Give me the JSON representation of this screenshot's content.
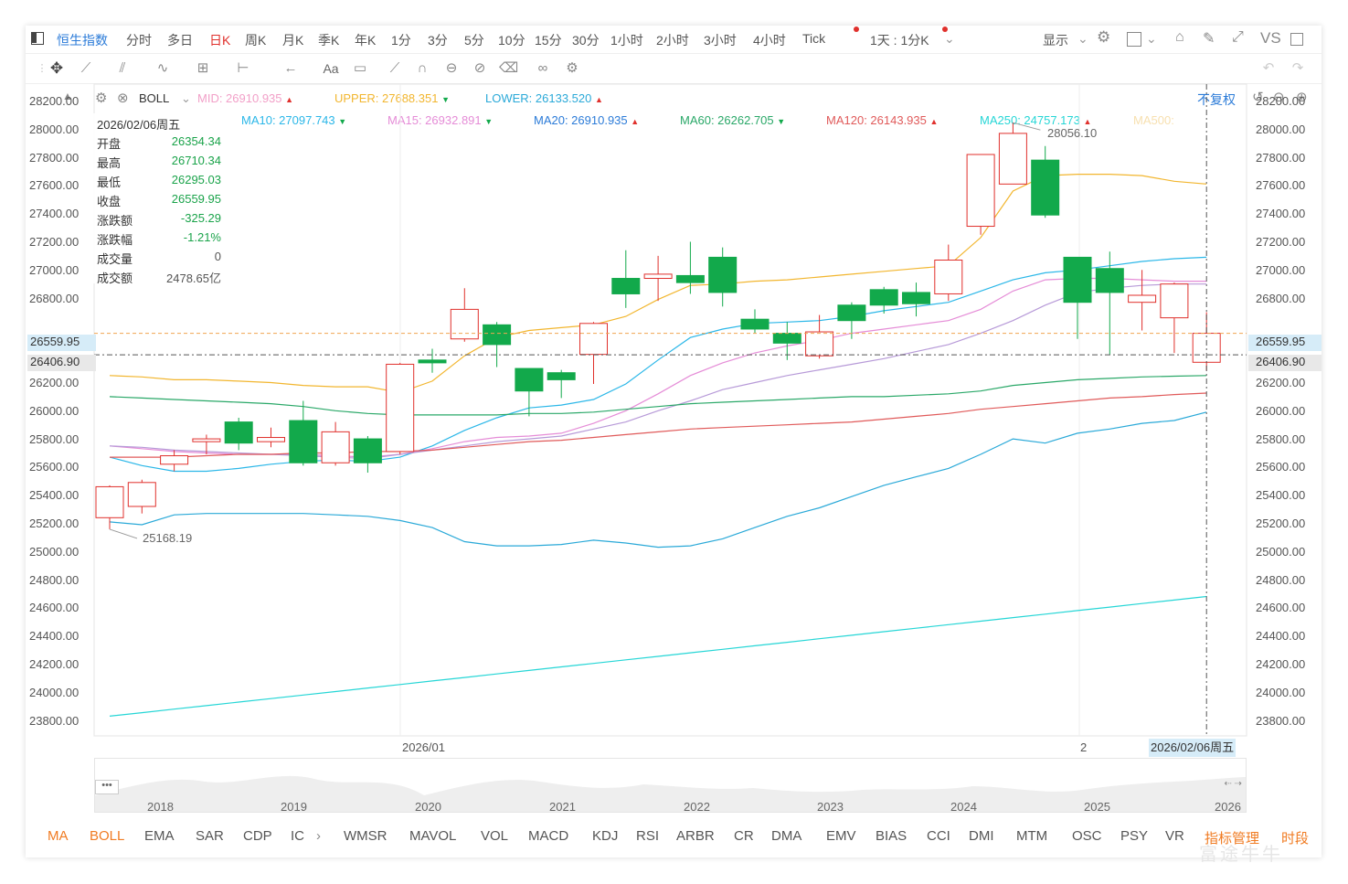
{
  "toolbar": {
    "title": "恒生指数",
    "periods": [
      "分时",
      "多日",
      "日K",
      "周K",
      "月K",
      "季K",
      "年K",
      "1分",
      "3分",
      "5分",
      "10分",
      "15分",
      "30分",
      "1小时",
      "2小时",
      "3小时",
      "4小时",
      "Tick"
    ],
    "active_period": "日K",
    "period_setting": "1天 : 1分K",
    "display_label": "显示",
    "vs_label": "VS"
  },
  "indicator": {
    "name": "BOLL",
    "mid": "MID:  26910.935",
    "upper": "UPPER:  27688.351",
    "lower": "LOWER:  26133.520",
    "restore_label": "不复权"
  },
  "ma_line": {
    "ma10": "MA10:  27097.743",
    "ma15": "MA15:  26932.891",
    "ma20": "MA20:  26910.935",
    "ma60": "MA60:  26262.705",
    "ma120": "MA120:  26143.935",
    "ma250": "MA250:  24757.173",
    "ma500": "MA500:"
  },
  "info": {
    "date": "2026/02/06周五",
    "rows": [
      {
        "k": "开盘",
        "v": "26354.34",
        "color": "#1aa34a"
      },
      {
        "k": "最高",
        "v": "26710.34",
        "color": "#1aa34a"
      },
      {
        "k": "最低",
        "v": "26295.03",
        "color": "#1aa34a"
      },
      {
        "k": "收盘",
        "v": "26559.95",
        "color": "#1aa34a"
      },
      {
        "k": "涨跌额",
        "v": "-325.29",
        "color": "#1aa34a"
      },
      {
        "k": "涨跌幅",
        "v": "-1.21%",
        "color": "#1aa34a"
      },
      {
        "k": "成交量",
        "v": "0",
        "color": "#555"
      },
      {
        "k": "成交额",
        "v": "2478.65亿",
        "color": "#555"
      }
    ]
  },
  "y_axis": [
    "28200.00",
    "28000.00",
    "27800.00",
    "27600.00",
    "27400.00",
    "27200.00",
    "27000.00",
    "26800.00",
    "26200.00",
    "26000.00",
    "25800.00",
    "25600.00",
    "25400.00",
    "25200.00",
    "25000.00",
    "24800.00",
    "24600.00",
    "24400.00",
    "24200.00",
    "24000.00",
    "23800.00"
  ],
  "price_labels": {
    "current": "26559.95",
    "crosshair": "26406.90"
  },
  "annotations": {
    "high": "28056.10",
    "low": "25168.19"
  },
  "x_axis": {
    "jan": "2026/01",
    "feb": "2",
    "cursor": "2026/02/06周五"
  },
  "overview_years": [
    "2018",
    "2019",
    "2020",
    "2021",
    "2022",
    "2023",
    "2024",
    "2025",
    "2026"
  ],
  "bottom_tabs": [
    "MA",
    "BOLL",
    "EMA",
    "SAR",
    "CDP",
    "IC",
    "WMSR",
    "MAVOL",
    "VOL",
    "MACD",
    "KDJ",
    "RSI",
    "ARBR",
    "CR",
    "DMA",
    "EMV",
    "BIAS",
    "CCI",
    "DMI",
    "MTM",
    "OSC",
    "PSY",
    "VR"
  ],
  "bottom_right": {
    "manage": "指标管理",
    "period": "时段"
  },
  "watermark": "富途牛牛",
  "colors": {
    "up": "#e0302c",
    "down": "#12a94b",
    "accent": "#2b7bd8",
    "orange": "#f07b22"
  },
  "chart_data": {
    "type": "candlestick",
    "candles": [
      {
        "o": 25250,
        "h": 25480,
        "l": 25168,
        "c": 25470
      },
      {
        "o": 25330,
        "h": 25520,
        "l": 25280,
        "c": 25500
      },
      {
        "o": 25630,
        "h": 25730,
        "l": 25580,
        "c": 25690
      },
      {
        "o": 25790,
        "h": 25840,
        "l": 25700,
        "c": 25810
      },
      {
        "o": 25930,
        "h": 25960,
        "l": 25730,
        "c": 25780
      },
      {
        "o": 25790,
        "h": 25890,
        "l": 25750,
        "c": 25820
      },
      {
        "o": 25940,
        "h": 26080,
        "l": 25620,
        "c": 25640
      },
      {
        "o": 25640,
        "h": 25930,
        "l": 25620,
        "c": 25860
      },
      {
        "o": 25810,
        "h": 25830,
        "l": 25570,
        "c": 25640
      },
      {
        "o": 25720,
        "h": 26350,
        "l": 25700,
        "c": 26340
      },
      {
        "o": 26370,
        "h": 26450,
        "l": 26280,
        "c": 26350
      },
      {
        "o": 26520,
        "h": 26880,
        "l": 26500,
        "c": 26730
      },
      {
        "o": 26620,
        "h": 26640,
        "l": 26320,
        "c": 26480
      },
      {
        "o": 26310,
        "h": 26310,
        "l": 25970,
        "c": 26150
      },
      {
        "o": 26280,
        "h": 26300,
        "l": 26100,
        "c": 26230
      },
      {
        "o": 26410,
        "h": 26640,
        "l": 26200,
        "c": 26630
      },
      {
        "o": 26950,
        "h": 27150,
        "l": 26740,
        "c": 26840
      },
      {
        "o": 26950,
        "h": 27110,
        "l": 26790,
        "c": 26980
      },
      {
        "o": 26970,
        "h": 27210,
        "l": 26840,
        "c": 26920
      },
      {
        "o": 27100,
        "h": 27170,
        "l": 26750,
        "c": 26850
      },
      {
        "o": 26660,
        "h": 26730,
        "l": 26560,
        "c": 26590
      },
      {
        "o": 26560,
        "h": 26640,
        "l": 26370,
        "c": 26490
      },
      {
        "o": 26400,
        "h": 26690,
        "l": 26380,
        "c": 26570
      },
      {
        "o": 26760,
        "h": 26780,
        "l": 26520,
        "c": 26650
      },
      {
        "o": 26870,
        "h": 26890,
        "l": 26700,
        "c": 26760
      },
      {
        "o": 26850,
        "h": 26920,
        "l": 26680,
        "c": 26770
      },
      {
        "o": 26840,
        "h": 27190,
        "l": 26790,
        "c": 27080
      },
      {
        "o": 27320,
        "h": 27830,
        "l": 27260,
        "c": 27830
      },
      {
        "o": 27620,
        "h": 28056,
        "l": 27620,
        "c": 27980
      },
      {
        "o": 27790,
        "h": 27890,
        "l": 27380,
        "c": 27400
      },
      {
        "o": 27100,
        "h": 27100,
        "l": 26520,
        "c": 26780
      },
      {
        "o": 27020,
        "h": 27140,
        "l": 26410,
        "c": 26850
      },
      {
        "o": 26780,
        "h": 27010,
        "l": 26580,
        "c": 26830
      },
      {
        "o": 26670,
        "h": 26920,
        "l": 26420,
        "c": 26910
      },
      {
        "o": 26354,
        "h": 26710,
        "l": 26295,
        "c": 26560
      }
    ],
    "lines": [
      {
        "name": "UPPER",
        "color": "#f2b62f",
        "v": [
          26260,
          26250,
          26230,
          26230,
          26220,
          26210,
          26190,
          26180,
          26180,
          26140,
          26220,
          26400,
          26530,
          26580,
          26600,
          26620,
          26680,
          26800,
          26900,
          26910,
          26930,
          26940,
          26960,
          26980,
          27000,
          27020,
          27040,
          27240,
          27570,
          27680,
          27690,
          27690,
          27680,
          27640,
          27620,
          27688
        ]
      },
      {
        "name": "MA10",
        "color": "#2bb7e8",
        "v": [
          25680,
          25620,
          25580,
          25580,
          25600,
          25630,
          25650,
          25660,
          25650,
          25680,
          25760,
          25870,
          25960,
          26030,
          26050,
          26090,
          26200,
          26370,
          26530,
          26590,
          26630,
          26640,
          26650,
          26680,
          26720,
          26750,
          26780,
          26860,
          26940,
          26990,
          27010,
          27040,
          27070,
          27090,
          27100,
          27098
        ]
      },
      {
        "name": "MA15",
        "color": "#e58cd7",
        "v": [
          25760,
          25740,
          25720,
          25710,
          25700,
          25700,
          25700,
          25690,
          25680,
          25700,
          25740,
          25790,
          25820,
          25830,
          25850,
          25920,
          26010,
          26130,
          26260,
          26350,
          26420,
          26470,
          26510,
          26560,
          26590,
          26620,
          26650,
          26730,
          26860,
          26940,
          26950,
          26950,
          26940,
          26930,
          26930,
          26933
        ]
      },
      {
        "name": "MA20",
        "color": "#b79ad8",
        "v": [
          25760,
          25750,
          25730,
          25720,
          25710,
          25700,
          25690,
          25680,
          25670,
          25700,
          25730,
          25760,
          25790,
          25810,
          25830,
          25880,
          25930,
          26010,
          26080,
          26160,
          26210,
          26260,
          26300,
          26340,
          26380,
          26430,
          26480,
          26560,
          26650,
          26760,
          26850,
          26880,
          26900,
          26910,
          26910,
          26911
        ]
      },
      {
        "name": "MA60",
        "color": "#2aa868",
        "v": [
          26110,
          26100,
          26090,
          26080,
          26070,
          26060,
          26040,
          26010,
          25990,
          25980,
          25980,
          25980,
          25980,
          25990,
          25990,
          26000,
          26020,
          26040,
          26060,
          26070,
          26080,
          26090,
          26100,
          26110,
          26110,
          26120,
          26130,
          26150,
          26190,
          26210,
          26230,
          26240,
          26250,
          26255,
          26260,
          26263
        ]
      },
      {
        "name": "MA120",
        "color": "#e05a5a",
        "v": [
          25680,
          25680,
          25680,
          25690,
          25700,
          25700,
          25710,
          25710,
          25720,
          25720,
          25730,
          25750,
          25770,
          25790,
          25800,
          25820,
          25840,
          25860,
          25880,
          25890,
          25900,
          25910,
          25920,
          25930,
          25950,
          25970,
          25990,
          26020,
          26040,
          26060,
          26080,
          26100,
          26110,
          26125,
          26135,
          26144
        ]
      },
      {
        "name": "LOWER",
        "color": "#2aa9d8",
        "v": [
          25220,
          25200,
          25270,
          25280,
          25280,
          25280,
          25280,
          25270,
          25260,
          25230,
          25180,
          25080,
          25050,
          25050,
          25060,
          25090,
          25070,
          25040,
          25050,
          25100,
          25180,
          25260,
          25320,
          25400,
          25480,
          25540,
          25600,
          25700,
          25810,
          25780,
          25850,
          25880,
          25920,
          25940,
          26000,
          26134
        ]
      },
      {
        "name": "MA250",
        "color": "#26d6d6",
        "v": [
          23840,
          23865,
          23890,
          23915,
          23940,
          23965,
          23990,
          24015,
          24040,
          24065,
          24090,
          24115,
          24140,
          24165,
          24190,
          24215,
          24240,
          24265,
          24290,
          24315,
          24340,
          24365,
          24390,
          24415,
          24440,
          24465,
          24490,
          24515,
          24540,
          24565,
          24590,
          24615,
          24640,
          24665,
          24690,
          24757
        ]
      }
    ],
    "ylim": [
      23700,
      28330
    ]
  }
}
